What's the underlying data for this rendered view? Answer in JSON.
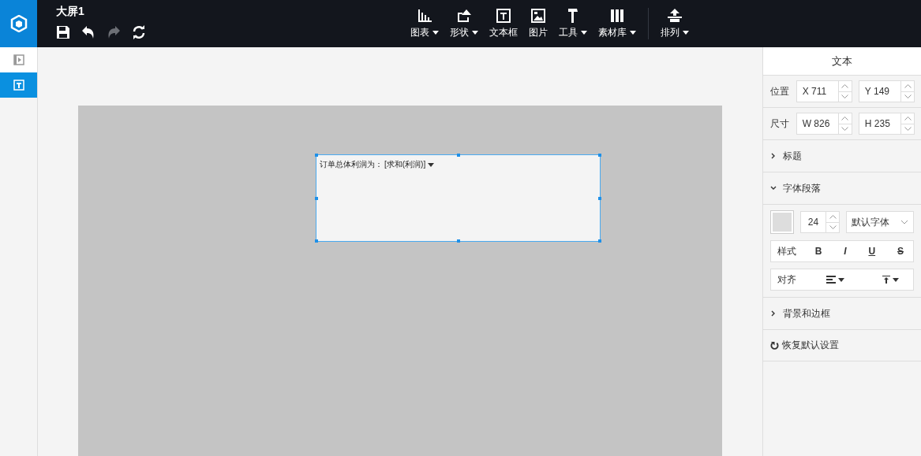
{
  "document": {
    "title": "大屏1"
  },
  "quick_actions": [
    {
      "kind": "save",
      "disabled": false
    },
    {
      "kind": "undo",
      "disabled": false
    },
    {
      "kind": "redo",
      "disabled": true
    },
    {
      "kind": "refresh",
      "disabled": false
    }
  ],
  "toolbar": [
    {
      "kind": "chart",
      "label": "图表",
      "has_menu": true
    },
    {
      "kind": "shape",
      "label": "形状",
      "has_menu": true
    },
    {
      "kind": "textbox",
      "label": "文本框",
      "has_menu": false
    },
    {
      "kind": "image",
      "label": "图片",
      "has_menu": false
    },
    {
      "kind": "tool",
      "label": "工具",
      "has_menu": true
    },
    {
      "kind": "library",
      "label": "素材库",
      "has_menu": true
    }
  ],
  "arrange": {
    "label": "排列",
    "has_menu": true
  },
  "sidebar": [
    {
      "kind": "panel",
      "selected": false
    },
    {
      "kind": "text",
      "selected": true
    }
  ],
  "canvas": {
    "text_box": {
      "text": "订单总体利润为：",
      "field": "[求和(利润)]",
      "selected": true
    }
  },
  "panel": {
    "title": "文本",
    "position": {
      "label": "位置",
      "fields": [
        {
          "prefix": "X",
          "value": "711"
        },
        {
          "prefix": "Y",
          "value": "149"
        }
      ]
    },
    "size": {
      "label": "尺寸",
      "fields": [
        {
          "prefix": "W",
          "value": "826"
        },
        {
          "prefix": "H",
          "value": "235"
        }
      ]
    },
    "sections": [
      {
        "title": "标题",
        "expanded": false
      },
      {
        "title": "字体段落",
        "expanded": true
      },
      {
        "title": "背景和边框",
        "expanded": false
      }
    ],
    "font": {
      "size": "24",
      "family": "默认字体",
      "style_label": "样式",
      "styles": [
        {
          "kind": "bold",
          "label": "B"
        },
        {
          "kind": "italic",
          "label": "I"
        },
        {
          "kind": "underline",
          "label": "U"
        },
        {
          "kind": "strike",
          "label": "S"
        }
      ],
      "align_label": "对齐"
    },
    "reset": "恢复默认设置"
  }
}
